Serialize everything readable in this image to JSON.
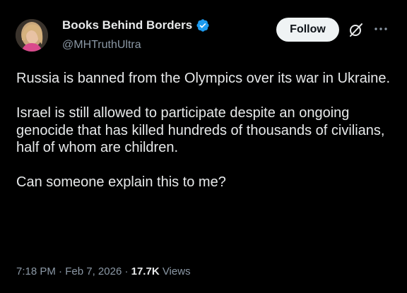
{
  "post": {
    "author": {
      "display_name": "Books Behind Borders",
      "handle": "@MHTruthUltra",
      "verified": true
    },
    "follow_label": "Follow",
    "text": {
      "paragraph_1": "Russia is banned from the Olympics over its war in Ukraine.",
      "paragraph_2": "Israel is still allowed to participate despite an ongoing genocide that has killed hundreds of thousands of civilians, half of whom are children.",
      "paragraph_3": "Can someone explain this to me?"
    },
    "meta": {
      "time": "7:18 PM",
      "separator": "·",
      "date": "Feb 7, 2026",
      "views_count": "17.7K",
      "views_label": "Views"
    }
  },
  "icons": {
    "verified": "verified-badge-icon",
    "grok": "grok-icon",
    "more": "more-options-icon"
  },
  "colors": {
    "background": "#000000",
    "primary_text": "#e7e9ea",
    "secondary_text": "#8b98a5",
    "verified_blue": "#1d9bf0",
    "follow_button_bg": "#eff3f4"
  }
}
